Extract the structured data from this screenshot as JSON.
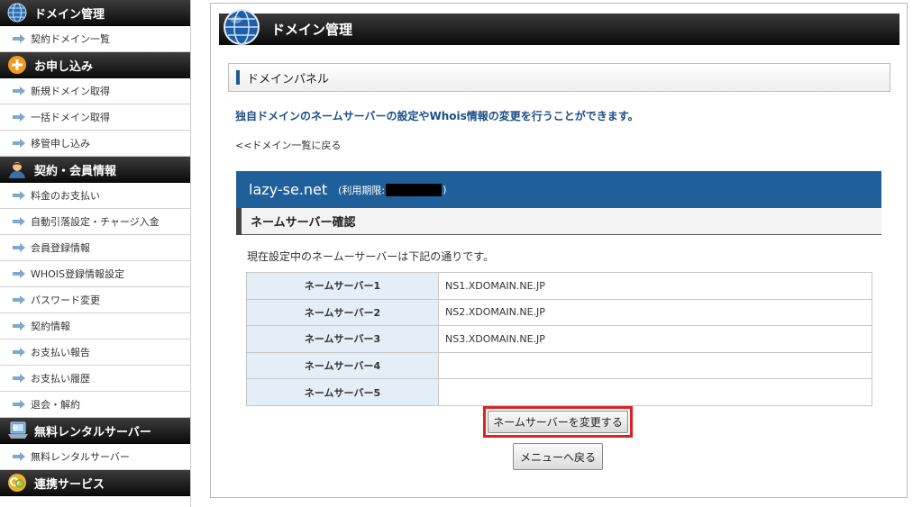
{
  "sidebar": {
    "sections": [
      {
        "title": "ドメイン管理",
        "icon": "globe-icon",
        "items": [
          "契約ドメイン一覧"
        ]
      },
      {
        "title": "お申し込み",
        "icon": "plus-circle-icon",
        "items": [
          "新規ドメイン取得",
          "一括ドメイン取得",
          "移管申し込み"
        ]
      },
      {
        "title": "契約・会員情報",
        "icon": "user-icon",
        "items": [
          "料金のお支払い",
          "自動引落設定・チャージ入金",
          "会員登録情報",
          "WHOIS登録情報設定",
          "パスワード変更",
          "契約情報",
          "お支払い報告",
          "お支払い履歴",
          "退会・解約"
        ]
      },
      {
        "title": "無料レンタルサーバー",
        "icon": "server-icon",
        "items": [
          "無料レンタルサーバー"
        ]
      },
      {
        "title": "連携サービス",
        "icon": "link-service-icon",
        "items": []
      }
    ]
  },
  "main": {
    "page_title": "ドメイン管理",
    "panel_title": "ドメインパネル",
    "intro": "独自ドメインのネームサーバーの設定やWhois情報の変更を行うことができます。",
    "back_link": "<<ドメイン一覧に戻る",
    "domain_name": "lazy-se.net",
    "expiry_prefix": "(利用期限:",
    "expiry_suffix": ")",
    "ns_section_title": "ネームサーバー確認",
    "ns_description": "現在設定中のネームーサーバーは下記の通りです。",
    "nameservers": [
      {
        "label": "ネームサーバー1",
        "value": "NS1.XDOMAIN.NE.JP"
      },
      {
        "label": "ネームサーバー2",
        "value": "NS2.XDOMAIN.NE.JP"
      },
      {
        "label": "ネームサーバー3",
        "value": "NS3.XDOMAIN.NE.JP"
      },
      {
        "label": "ネームサーバー4",
        "value": ""
      },
      {
        "label": "ネームサーバー5",
        "value": ""
      }
    ],
    "change_button": "ネームサーバーを変更する",
    "menu_button": "メニューへ戻る"
  },
  "colors": {
    "accent_blue": "#20609a",
    "highlight_red": "#e02020",
    "table_label_bg": "#e4eef7"
  }
}
